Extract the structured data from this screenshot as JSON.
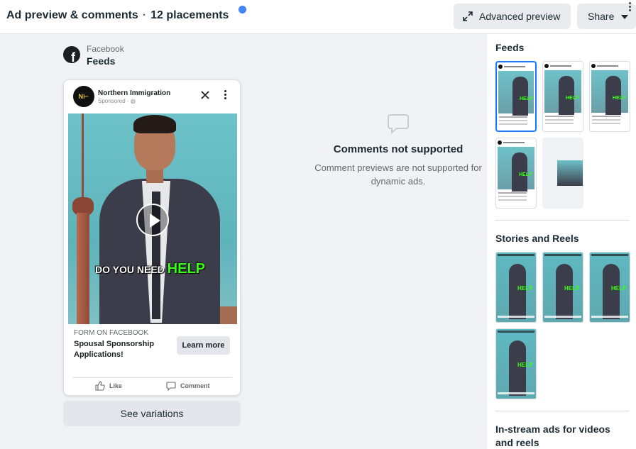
{
  "header": {
    "title": "Ad preview & comments",
    "separator": "·",
    "placements": "12 placements",
    "advanced_preview_label": "Advanced preview",
    "share_label": "Share"
  },
  "preview": {
    "platform": "Facebook",
    "placement": "Feeds",
    "logo_letter": "f"
  },
  "ad": {
    "advertiser_name": "Northern Immigration",
    "advertiser_initials": "N⊢",
    "sponsored": "Sponsored · ",
    "globe": "◍",
    "caption_prefix": "DO YOU NEED ",
    "caption_highlight": "HELP",
    "cta_type": "FORM ON FACEBOOK",
    "cta_title": "Spousal Sponsorship Applications!",
    "cta_button": "Learn more",
    "like_label": "Like",
    "comment_label": "Comment"
  },
  "see_variations_label": "See variations",
  "comments": {
    "title": "Comments not supported",
    "subtitle": "Comment previews are not supported for dynamic ads."
  },
  "right_panel": {
    "sections": [
      {
        "title": "Feeds"
      },
      {
        "title": "Stories and Reels"
      },
      {
        "title": "In-stream ads for videos and reels"
      }
    ]
  },
  "colors": {
    "accent": "#1877f2",
    "caption_highlight": "#39ff14",
    "notification_dot": "#4285f4"
  }
}
